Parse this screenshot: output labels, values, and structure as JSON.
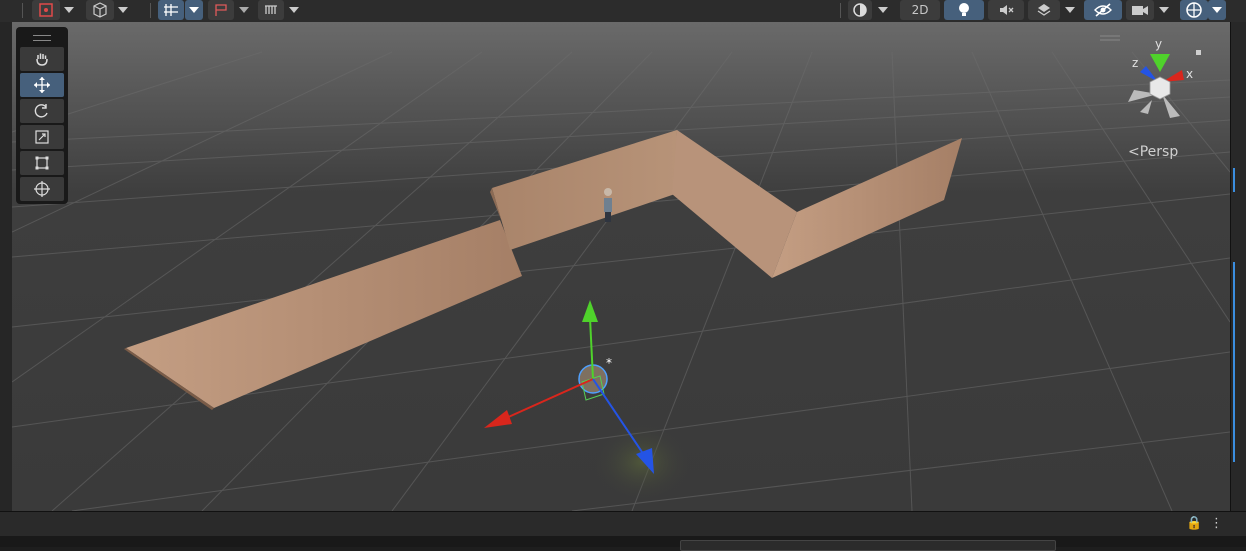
{
  "toolbar": {
    "button_2d_label": "2D",
    "left_tools": [
      "gizmo-icon",
      "cube-icon",
      "grid-snap-icon",
      "increment-snap-icon",
      "ruler-icon"
    ],
    "right_tools": [
      "shading-mode-icon",
      "2d-toggle",
      "lighting-icon",
      "audio-icon",
      "effects-icon",
      "hidden-objects-icon",
      "camera-icon",
      "gizmos-icon"
    ]
  },
  "tools_overlay": {
    "items": [
      "hand-tool",
      "move-tool",
      "rotate-tool",
      "scale-tool",
      "rect-tool",
      "transform-tool"
    ],
    "active": "move-tool"
  },
  "orientation_gizmo": {
    "axis_y": "y",
    "axis_x": "x",
    "axis_z": "z",
    "projection_label": "Persp"
  },
  "colors": {
    "active_button": "#46607c",
    "axis_x": "#d9261c",
    "axis_y": "#4fd22b",
    "axis_z": "#2454e5",
    "wall": "#b08a6f"
  },
  "scene": {
    "objects": [
      "wall-section-left",
      "wall-section-middle",
      "wall-section-right",
      "character",
      "selected-object"
    ]
  }
}
